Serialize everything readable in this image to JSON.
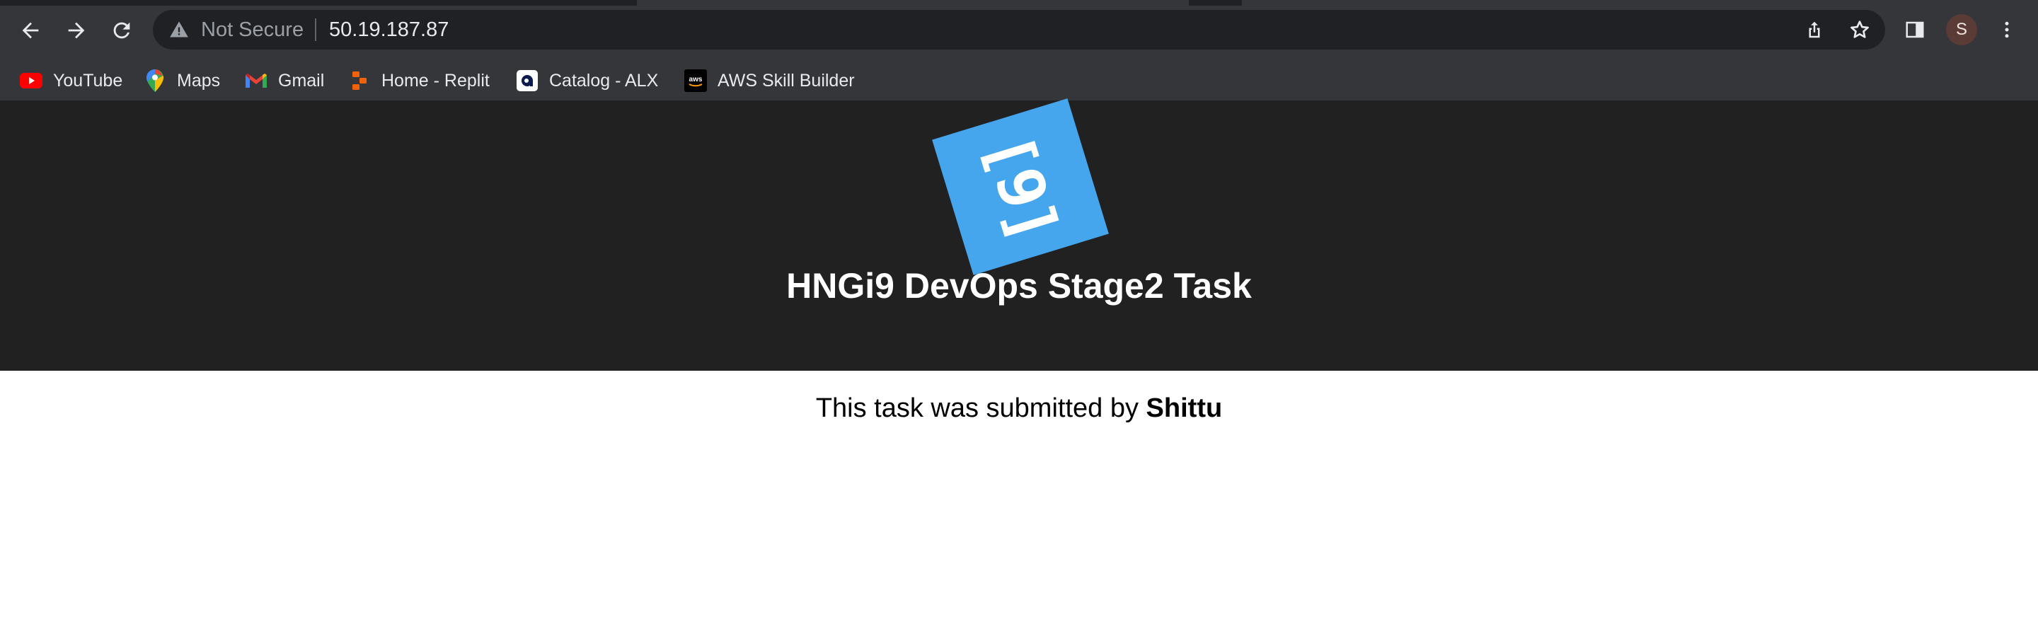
{
  "browser": {
    "security_label": "Not Secure",
    "url": "50.19.187.87",
    "profile_initial": "S",
    "icons": {
      "back": "back-arrow-icon",
      "forward": "forward-arrow-icon",
      "reload": "reload-icon",
      "warning": "warning-triangle-icon",
      "share": "share-icon",
      "bookmark": "star-icon",
      "side_panel": "side-panel-icon",
      "menu": "kebab-menu-icon"
    }
  },
  "bookmarks": [
    {
      "label": "YouTube",
      "icon": "youtube-icon"
    },
    {
      "label": "Maps",
      "icon": "maps-pin-icon"
    },
    {
      "label": "Gmail",
      "icon": "gmail-icon"
    },
    {
      "label": "Home - Replit",
      "icon": "replit-icon"
    },
    {
      "label": "Catalog - ALX",
      "icon": "alx-icon"
    },
    {
      "label": "AWS Skill Builder",
      "icon": "aws-icon"
    }
  ],
  "page": {
    "logo_glyph": "[9]",
    "title": "HNGi9 DevOps Stage2 Task",
    "submitted_prefix": "This task was submitted by ",
    "submitted_name": "Shittu",
    "colors": {
      "hero_bg": "#212121",
      "logo_bg": "#45a6ee",
      "title": "#ffffff"
    }
  }
}
